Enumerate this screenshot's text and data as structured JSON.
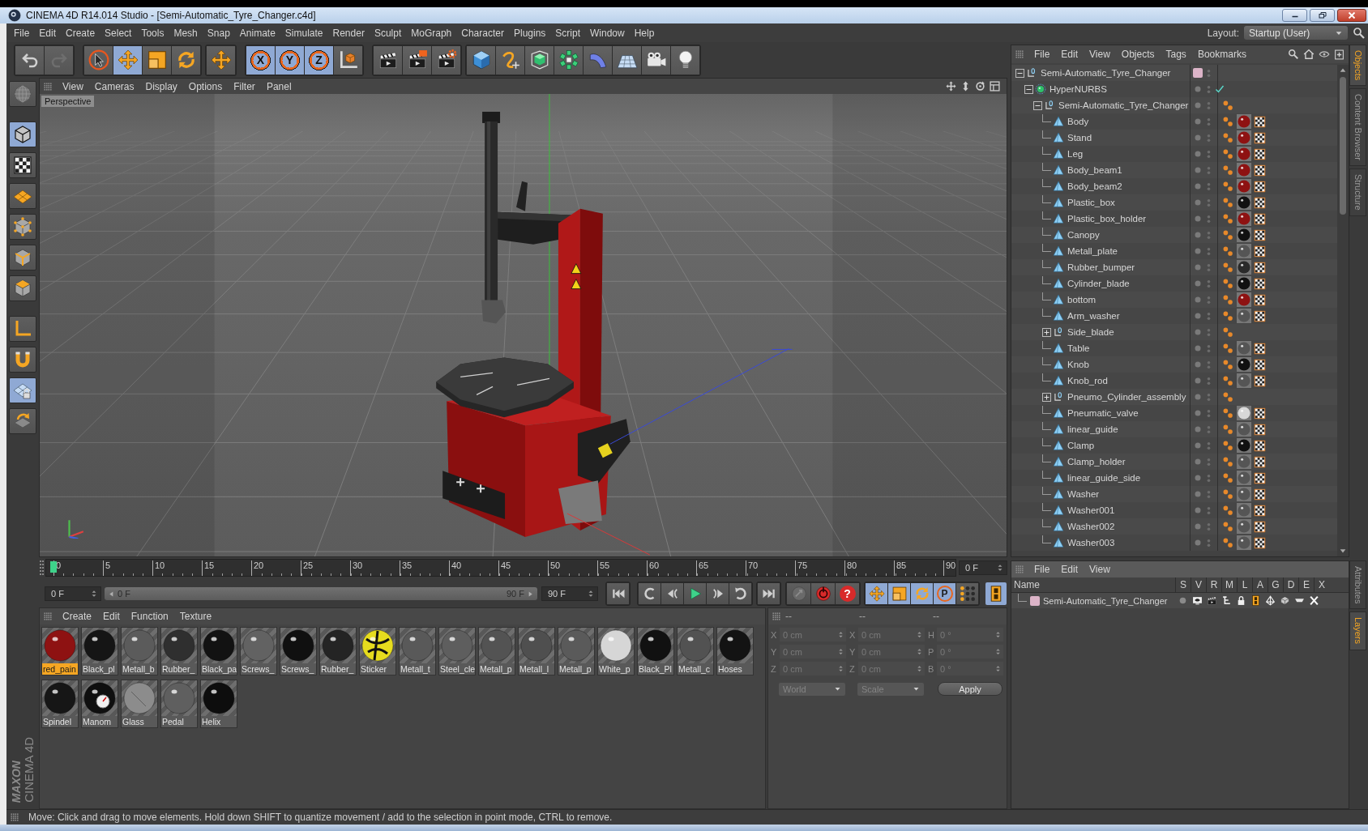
{
  "window": {
    "title": "CINEMA 4D R14.014 Studio - [Semi-Automatic_Tyre_Changer.c4d]"
  },
  "menu_bar": {
    "items": [
      "File",
      "Edit",
      "Create",
      "Select",
      "Tools",
      "Mesh",
      "Snap",
      "Animate",
      "Simulate",
      "Render",
      "Sculpt",
      "MoGraph",
      "Character",
      "Plugins",
      "Script",
      "Window",
      "Help"
    ],
    "layout_label": "Layout:",
    "layout_value": "Startup (User)"
  },
  "toolbar": {
    "tools": [
      {
        "selected": false
      },
      {
        "selected": true
      },
      {
        "selected": false
      },
      {
        "selected": false
      }
    ],
    "axis_locks": [
      {
        "label": "X",
        "on": true
      },
      {
        "label": "Y",
        "on": true
      },
      {
        "label": "Z",
        "on": true
      }
    ]
  },
  "mode_palette": {
    "modes": [
      {
        "selected": false
      },
      {
        "selected": true
      },
      {
        "selected": false
      },
      {
        "selected": false
      },
      {
        "selected": false
      },
      {
        "selected": false
      },
      {
        "selected": false
      },
      {
        "selected": false
      },
      {
        "selected": false
      },
      {
        "selected": true
      },
      {
        "selected": false
      }
    ]
  },
  "logo": {
    "brand": "MAXON",
    "product": "CINEMA 4D"
  },
  "viewport": {
    "menu": [
      "View",
      "Cameras",
      "Display",
      "Options",
      "Filter",
      "Panel"
    ],
    "camera": "Perspective"
  },
  "timeline": {
    "ticks": [
      "0",
      "5",
      "10",
      "15",
      "20",
      "25",
      "30",
      "35",
      "40",
      "45",
      "50",
      "55",
      "60",
      "65",
      "70",
      "75",
      "80",
      "85",
      "90"
    ],
    "playhead": {
      "level": 0
    },
    "current_frame": "0 F",
    "start_field": "0 F",
    "range": {
      "level": 1
    },
    "range_start": "0 F",
    "range_end": "90 F",
    "end_field": "90 F",
    "help_label": "?",
    "key_filters": [
      {
        "on": true
      },
      {
        "on": true
      },
      {
        "on": true
      },
      {
        "label": "P",
        "on": true
      },
      {
        "on": false
      }
    ],
    "timeline_button": {
      "on": true
    }
  },
  "material_manager": {
    "menu": [
      "Create",
      "Edit",
      "Function",
      "Texture"
    ],
    "materials": [
      {
        "name": "red_pain",
        "kind": "glossy",
        "color": "#8e1212",
        "selected": true
      },
      {
        "name": "Black_pl",
        "kind": "glossy",
        "color": "#151515",
        "selected": false
      },
      {
        "name": "Metall_b",
        "kind": "glossy",
        "color": "#5b5b5b",
        "selected": false
      },
      {
        "name": "Rubber_",
        "kind": "glossy",
        "color": "#2f2f2f",
        "selected": false
      },
      {
        "name": "Black_pa",
        "kind": "glossy",
        "color": "#121212",
        "selected": false
      },
      {
        "name": "Screws_",
        "kind": "glossy",
        "color": "#626262",
        "selected": false
      },
      {
        "name": "Screws_",
        "kind": "glossy",
        "color": "#101010",
        "selected": false
      },
      {
        "name": "Rubber_",
        "kind": "glossy",
        "color": "#242424",
        "selected": false
      },
      {
        "name": "Sticker",
        "kind": "sticker",
        "color": "#e6dc1e",
        "selected": false
      },
      {
        "name": "Metall_t",
        "kind": "glossy",
        "color": "#595959",
        "selected": false
      },
      {
        "name": "Steel_cle",
        "kind": "glossy",
        "color": "#5e5e5e",
        "selected": false
      },
      {
        "name": "Metall_p",
        "kind": "glossy",
        "color": "#535353",
        "selected": false
      },
      {
        "name": "Metall_l",
        "kind": "glossy",
        "color": "#4f4f4f",
        "selected": false
      },
      {
        "name": "Metall_p",
        "kind": "glossy",
        "color": "#5a5a5a",
        "selected": false
      },
      {
        "name": "White_p",
        "kind": "glossy",
        "color": "#d6d6d6",
        "selected": false
      },
      {
        "name": "Black_Pl",
        "kind": "glossy",
        "color": "#111111",
        "selected": false
      },
      {
        "name": "Metall_c",
        "kind": "glossy",
        "color": "#525252",
        "selected": false
      },
      {
        "name": "Hoses",
        "kind": "glossy",
        "color": "#131313",
        "selected": false
      },
      {
        "name": "Spindel",
        "kind": "glossy",
        "color": "#161616",
        "selected": false
      },
      {
        "name": "Manom",
        "kind": "gauge",
        "color": "#0f0f0f",
        "selected": false
      },
      {
        "name": "Glass",
        "kind": "glass",
        "color": "#8c8c8c",
        "selected": false
      },
      {
        "name": "Pedal",
        "kind": "glossy",
        "color": "#5f5f5f",
        "selected": false
      },
      {
        "name": "Helix",
        "kind": "glossy",
        "color": "#0d0d0d",
        "selected": false
      }
    ]
  },
  "coordinates": {
    "disabled": true,
    "headers": [
      "--",
      "--",
      "--"
    ],
    "rows": [
      {
        "fields": [
          {
            "axis": "X",
            "value": "0 cm"
          },
          {
            "axis": "X",
            "value": "0 cm"
          },
          {
            "axis": "H",
            "value": "0 °"
          }
        ]
      },
      {
        "fields": [
          {
            "axis": "Y",
            "value": "0 cm"
          },
          {
            "axis": "Y",
            "value": "0 cm"
          },
          {
            "axis": "P",
            "value": "0 °"
          }
        ]
      },
      {
        "fields": [
          {
            "axis": "Z",
            "value": "0 cm"
          },
          {
            "axis": "Z",
            "value": "0 cm"
          },
          {
            "axis": "B",
            "value": "0 °"
          }
        ]
      }
    ],
    "dropdowns": [
      "World",
      "Scale"
    ],
    "apply": "Apply"
  },
  "object_manager": {
    "menu": [
      "File",
      "Edit",
      "View",
      "Objects",
      "Tags",
      "Bookmarks"
    ],
    "tree": [
      {
        "name": "Semi-Automatic_Tyre_Changer",
        "kind": "null",
        "expanded": true,
        "layer": {
          "color": "#dcb4c8"
        },
        "children": [
          {
            "name": "HyperNURBS",
            "kind": "generator",
            "expanded": true,
            "children": [
              {
                "name": "Semi-Automatic_Tyre_Changer",
                "kind": "null",
                "expanded": true,
                "tags": [
                  {
                    "kind": "phong"
                  }
                ],
                "children": [
                  {
                    "name": "Body",
                    "kind": "polygon",
                    "tags": [
                      {
                        "kind": "phong"
                      },
                      {
                        "kind": "material",
                        "color": "#8e1212"
                      },
                      {
                        "kind": "uvw"
                      }
                    ]
                  },
                  {
                    "name": "Stand",
                    "kind": "polygon",
                    "tags": [
                      {
                        "kind": "phong"
                      },
                      {
                        "kind": "material",
                        "color": "#8e1212"
                      },
                      {
                        "kind": "uvw"
                      }
                    ]
                  },
                  {
                    "name": "Leg",
                    "kind": "polygon",
                    "tags": [
                      {
                        "kind": "phong"
                      },
                      {
                        "kind": "material",
                        "color": "#8e1212"
                      },
                      {
                        "kind": "uvw"
                      }
                    ]
                  },
                  {
                    "name": "Body_beam1",
                    "kind": "polygon",
                    "tags": [
                      {
                        "kind": "phong"
                      },
                      {
                        "kind": "material",
                        "color": "#8e1212"
                      },
                      {
                        "kind": "uvw"
                      }
                    ]
                  },
                  {
                    "name": "Body_beam2",
                    "kind": "polygon",
                    "tags": [
                      {
                        "kind": "phong"
                      },
                      {
                        "kind": "material",
                        "color": "#8e1212"
                      },
                      {
                        "kind": "uvw"
                      }
                    ]
                  },
                  {
                    "name": "Plastic_box",
                    "kind": "polygon",
                    "tags": [
                      {
                        "kind": "phong"
                      },
                      {
                        "kind": "material",
                        "color": "#111111"
                      },
                      {
                        "kind": "uvw"
                      }
                    ]
                  },
                  {
                    "name": "Plastic_box_holder",
                    "kind": "polygon",
                    "tags": [
                      {
                        "kind": "phong"
                      },
                      {
                        "kind": "material",
                        "color": "#8e1212"
                      },
                      {
                        "kind": "uvw"
                      }
                    ]
                  },
                  {
                    "name": "Canopy",
                    "kind": "polygon",
                    "tags": [
                      {
                        "kind": "phong"
                      },
                      {
                        "kind": "material",
                        "color": "#111111"
                      },
                      {
                        "kind": "uvw"
                      }
                    ]
                  },
                  {
                    "name": "Metall_plate",
                    "kind": "polygon",
                    "tags": [
                      {
                        "kind": "phong"
                      },
                      {
                        "kind": "material",
                        "color": "#555555"
                      },
                      {
                        "kind": "uvw"
                      }
                    ]
                  },
                  {
                    "name": "Rubber_bumper",
                    "kind": "polygon",
                    "tags": [
                      {
                        "kind": "phong"
                      },
                      {
                        "kind": "material",
                        "color": "#2a2a2a"
                      },
                      {
                        "kind": "uvw"
                      }
                    ]
                  },
                  {
                    "name": "Cylinder_blade",
                    "kind": "polygon",
                    "tags": [
                      {
                        "kind": "phong"
                      },
                      {
                        "kind": "material",
                        "color": "#111111"
                      },
                      {
                        "kind": "uvw"
                      }
                    ]
                  },
                  {
                    "name": "bottom",
                    "kind": "polygon",
                    "tags": [
                      {
                        "kind": "phong"
                      },
                      {
                        "kind": "material",
                        "color": "#8e1212"
                      },
                      {
                        "kind": "uvw"
                      }
                    ]
                  },
                  {
                    "name": "Arm_washer",
                    "kind": "polygon",
                    "tags": [
                      {
                        "kind": "phong"
                      },
                      {
                        "kind": "material",
                        "color": "#555555"
                      },
                      {
                        "kind": "uvw"
                      }
                    ]
                  },
                  {
                    "name": "Side_blade",
                    "kind": "null",
                    "expanded": false,
                    "tags": [
                      {
                        "kind": "phong"
                      }
                    ]
                  },
                  {
                    "name": "Table",
                    "kind": "polygon",
                    "tags": [
                      {
                        "kind": "phong"
                      },
                      {
                        "kind": "material",
                        "color": "#555555"
                      },
                      {
                        "kind": "uvw"
                      }
                    ]
                  },
                  {
                    "name": "Knob",
                    "kind": "polygon",
                    "tags": [
                      {
                        "kind": "phong"
                      },
                      {
                        "kind": "material",
                        "color": "#111111"
                      },
                      {
                        "kind": "uvw"
                      }
                    ]
                  },
                  {
                    "name": "Knob_rod",
                    "kind": "polygon",
                    "tags": [
                      {
                        "kind": "phong"
                      },
                      {
                        "kind": "material",
                        "color": "#555555"
                      },
                      {
                        "kind": "uvw"
                      }
                    ]
                  },
                  {
                    "name": "Pneumo_Cylinder_assembly",
                    "kind": "null",
                    "expanded": false,
                    "tags": [
                      {
                        "kind": "phong"
                      }
                    ]
                  },
                  {
                    "name": "Pneumatic_valve",
                    "kind": "polygon",
                    "tags": [
                      {
                        "kind": "phong"
                      },
                      {
                        "kind": "material",
                        "color": "#d8d8d8"
                      },
                      {
                        "kind": "uvw"
                      }
                    ]
                  },
                  {
                    "name": "linear_guide",
                    "kind": "polygon",
                    "tags": [
                      {
                        "kind": "phong"
                      },
                      {
                        "kind": "material",
                        "color": "#555555"
                      },
                      {
                        "kind": "uvw"
                      }
                    ]
                  },
                  {
                    "name": "Clamp",
                    "kind": "polygon",
                    "tags": [
                      {
                        "kind": "phong"
                      },
                      {
                        "kind": "material",
                        "color": "#111111"
                      },
                      {
                        "kind": "uvw"
                      }
                    ]
                  },
                  {
                    "name": "Clamp_holder",
                    "kind": "polygon",
                    "tags": [
                      {
                        "kind": "phong"
                      },
                      {
                        "kind": "material",
                        "color": "#555555"
                      },
                      {
                        "kind": "uvw"
                      }
                    ]
                  },
                  {
                    "name": "linear_guide_side",
                    "kind": "polygon",
                    "tags": [
                      {
                        "kind": "phong"
                      },
                      {
                        "kind": "material",
                        "color": "#555555"
                      },
                      {
                        "kind": "uvw"
                      }
                    ]
                  },
                  {
                    "name": "Washer",
                    "kind": "polygon",
                    "tags": [
                      {
                        "kind": "phong"
                      },
                      {
                        "kind": "material",
                        "color": "#555555"
                      },
                      {
                        "kind": "uvw"
                      }
                    ]
                  },
                  {
                    "name": "Washer001",
                    "kind": "polygon",
                    "tags": [
                      {
                        "kind": "phong"
                      },
                      {
                        "kind": "material",
                        "color": "#555555"
                      },
                      {
                        "kind": "uvw"
                      }
                    ]
                  },
                  {
                    "name": "Washer002",
                    "kind": "polygon",
                    "tags": [
                      {
                        "kind": "phong"
                      },
                      {
                        "kind": "material",
                        "color": "#555555"
                      },
                      {
                        "kind": "uvw"
                      }
                    ]
                  },
                  {
                    "name": "Washer003",
                    "kind": "polygon",
                    "tags": [
                      {
                        "kind": "phong"
                      },
                      {
                        "kind": "material",
                        "color": "#555555"
                      },
                      {
                        "kind": "uvw"
                      }
                    ]
                  }
                ]
              }
            ]
          }
        ]
      }
    ]
  },
  "side_tabs": {
    "top": [
      {
        "label": "Objects",
        "selected": true
      },
      {
        "label": "Content Browser",
        "selected": false
      },
      {
        "label": "Structure",
        "selected": false
      }
    ],
    "bottom": [
      {
        "label": "Attributes",
        "selected": false
      },
      {
        "label": "Layers",
        "selected": true
      }
    ]
  },
  "layer_manager": {
    "menu": [
      "File",
      "Edit",
      "View"
    ],
    "columns": [
      "Name",
      "S",
      "V",
      "R",
      "M",
      "L",
      "A",
      "G",
      "D",
      "E",
      "X"
    ],
    "layers": [
      {
        "name": "Semi-Automatic_Tyre_Changer",
        "color": "#dcb4c8"
      }
    ]
  },
  "status_bar": {
    "text": "Move: Click and drag to move elements. Hold down SHIFT to quantize movement / add to the selection in point mode, CTRL to remove."
  }
}
